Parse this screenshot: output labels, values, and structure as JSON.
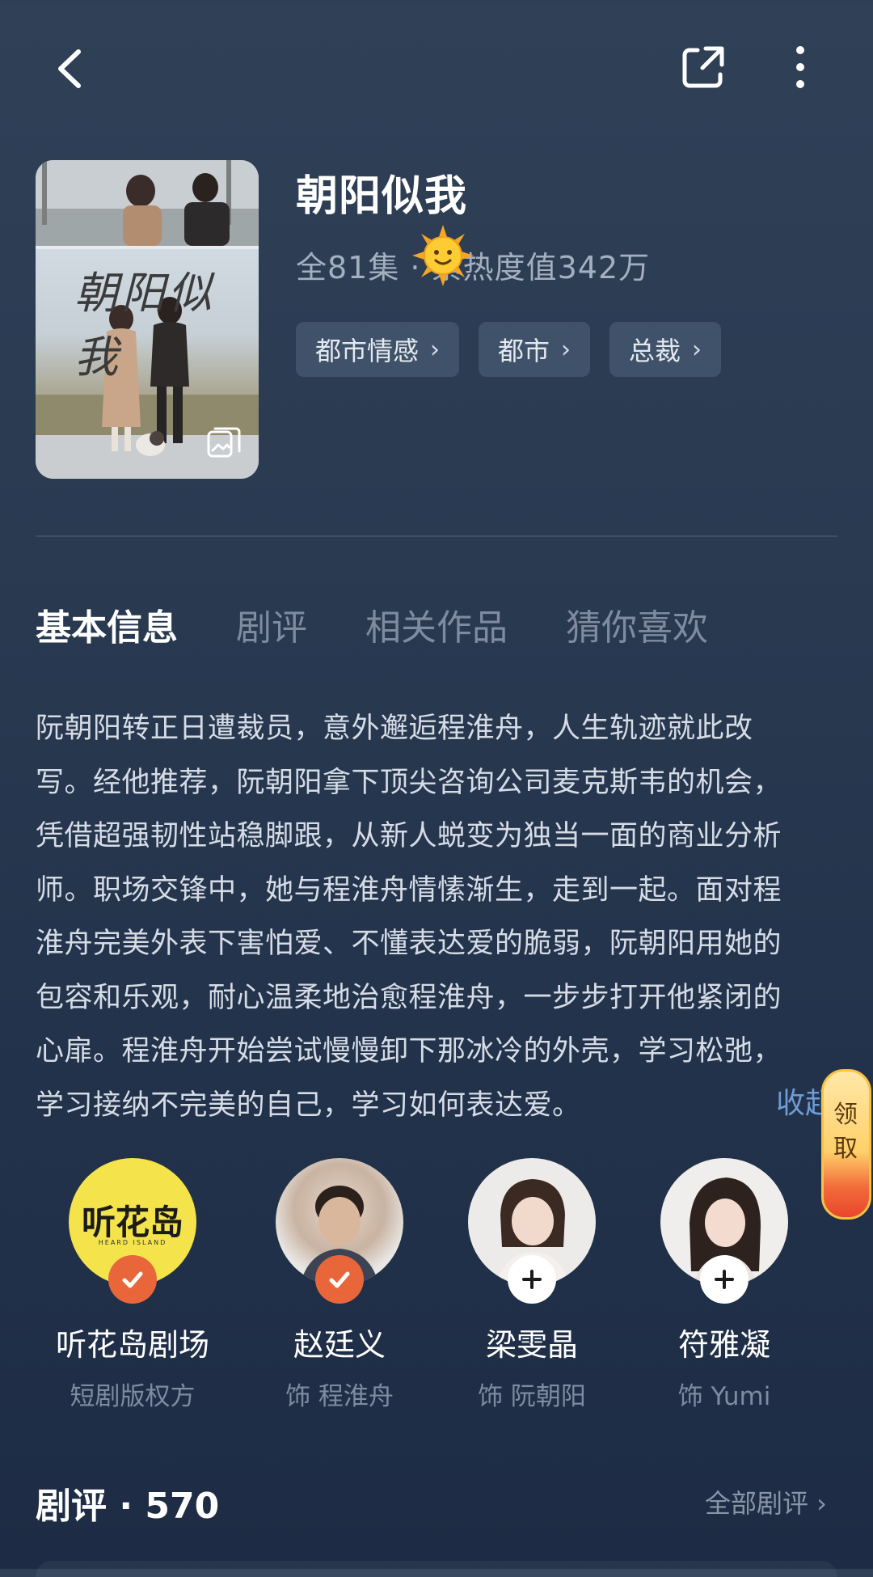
{
  "header": {
    "back_icon": "chevron-left-icon",
    "share_icon": "share-icon",
    "more_icon": "more-vertical-icon"
  },
  "poster": {
    "title_text": "朝阳似我",
    "gallery_icon": "gallery-icon"
  },
  "show": {
    "title": "朝阳似我",
    "meta": "全81集 · 累热度值342万",
    "badge_icon": "sun-emoji-icon",
    "tags": [
      {
        "label": "都市情感"
      },
      {
        "label": "都市"
      },
      {
        "label": "总裁"
      }
    ]
  },
  "tabs": [
    {
      "label": "基本信息",
      "active": true
    },
    {
      "label": "剧评",
      "active": false
    },
    {
      "label": "相关作品",
      "active": false
    },
    {
      "label": "猜你喜欢",
      "active": false
    }
  ],
  "synopsis": {
    "lines": [
      "阮朝阳转正日遭裁员，意外邂逅程淮舟，人生轨迹就此改",
      "写。经他推荐，阮朝阳拿下顶尖咨询公司麦克斯韦的机会，",
      "凭借超强韧性站稳脚跟，从新人蜕变为独当一面的商业分析",
      "师。职场交锋中，她与程淮舟情愫渐生，走到一起。面对程",
      "淮舟完美外表下害怕爱、不懂表达爱的脆弱，阮朝阳用她的",
      "包容和乐观，耐心温柔地治愈程淮舟，一步步打开他紧闭的",
      "心扉。程淮舟开始尝试慢慢卸下那冰冷的外壳，学习松弛，",
      "学习接纳不完美的自己，学习如何表达爱。"
    ],
    "collapse_label": "收起"
  },
  "claim_widget": {
    "label": "领取"
  },
  "cast": [
    {
      "name": "听花岛剧场",
      "role": "短剧版权方",
      "avatar_text": "听花岛",
      "avatar_subtext": "HEARD ISLAND",
      "followed": true
    },
    {
      "name": "赵廷义",
      "role": "饰 程淮舟",
      "followed": true
    },
    {
      "name": "梁雯晶",
      "role": "饰 阮朝阳",
      "followed": false
    },
    {
      "name": "符雅凝",
      "role": "饰 Yumi",
      "followed": false
    }
  ],
  "reviews": {
    "title": "剧评 · 570",
    "all_label": "全部剧评 ›"
  },
  "colors": {
    "accent_orange": "#e8663a",
    "link_blue": "#6f9bd6",
    "bg_top": "#2f4057",
    "bg_bottom": "#1d2c44"
  }
}
